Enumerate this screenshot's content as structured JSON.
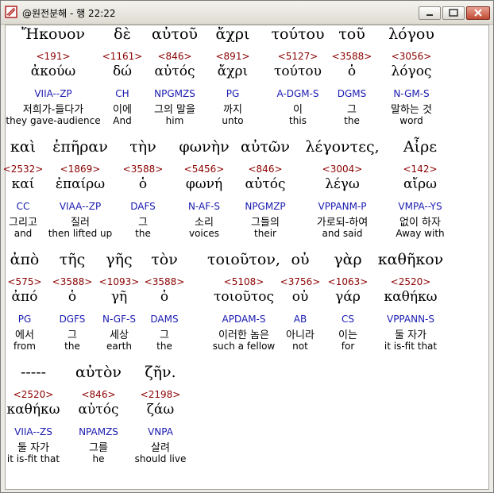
{
  "window": {
    "title": "@원전분해 - 행 22:22"
  },
  "rows": [
    {
      "tokens": [
        {
          "g": "Ἤκουον",
          "sn": "<191>",
          "lx": "ἀκούω",
          "pa": "VIIA--ZP",
          "ko": "저희가-들다가",
          "en": "they gave-audience"
        },
        {
          "g": "δὲ",
          "sn": "<1161>",
          "lx": "δώ",
          "pa": "CH",
          "ko": "이에",
          "en": "And"
        },
        {
          "g": "αὐτοῦ",
          "sn": "<846>",
          "lx": "αὐτός",
          "pa": "NPGMZS",
          "ko": "그의 말을",
          "en": "him"
        },
        {
          "g": "ἄχρι",
          "sn": "<891>",
          "lx": "ἄχρι",
          "pa": "PG",
          "ko": "까지",
          "en": "unto"
        },
        {
          "g": "τούτου",
          "sn": "<5127>",
          "lx": "τούτου",
          "pa": "A-DGM-S",
          "ko": "이",
          "en": "this"
        },
        {
          "g": "τοῦ",
          "sn": "<3588>",
          "lx": "ὁ",
          "pa": "DGMS",
          "ko": "그",
          "en": "the"
        },
        {
          "g": "λόγου",
          "sn": "<3056>",
          "lx": "λόγος",
          "pa": "N-GM-S",
          "ko": "말하는 것",
          "en": "word"
        }
      ]
    },
    {
      "tokens": [
        {
          "g": "καὶ",
          "sn": "<2532>",
          "lx": "καί",
          "pa": "CC",
          "ko": "그리고",
          "en": "and"
        },
        {
          "g": "ἐπῆραν",
          "sn": "<1869>",
          "lx": "ἐπαίρω",
          "pa": "VIAA--ZP",
          "ko": "질러",
          "en": "then lifted up"
        },
        {
          "g": "τὴν",
          "sn": "<3588>",
          "lx": "ὁ",
          "pa": "DAFS",
          "ko": "그",
          "en": "the"
        },
        {
          "g": "φωνὴν",
          "sn": "<5456>",
          "lx": "φωνή",
          "pa": "N-AF-S",
          "ko": "소리",
          "en": "voices"
        },
        {
          "g": "αὐτῶν",
          "sn": "<846>",
          "lx": "αὐτός",
          "pa": "NPGMZP",
          "ko": "그들의",
          "en": "their"
        },
        {
          "g": "λέγοντες,",
          "sn": "<3004>",
          "lx": "λέγω",
          "pa": "VPPANM-P",
          "ko": "가로되-하여",
          "en": "and said"
        },
        {
          "g": "Αἶρε",
          "sn": "<142>",
          "lx": "αἴρω",
          "pa": "VMPA--YS",
          "ko": "없이 하자",
          "en": "Away with"
        }
      ]
    },
    {
      "tokens": [
        {
          "g": "ἀπὸ",
          "sn": "<575>",
          "lx": "ἀπό",
          "pa": "PG",
          "ko": "에서",
          "en": "from"
        },
        {
          "g": "τῆς",
          "sn": "<3588>",
          "lx": "ὁ",
          "pa": "DGFS",
          "ko": "그",
          "en": "the"
        },
        {
          "g": "γῆς",
          "sn": "<1093>",
          "lx": "γῆ",
          "pa": "N-GF-S",
          "ko": "세상",
          "en": "earth"
        },
        {
          "g": "τὸν",
          "sn": "<3588>",
          "lx": "ὁ",
          "pa": "DAMS",
          "ko": "그",
          "en": "the"
        },
        {
          "g": "τοιοῦτον,",
          "sn": "<5108>",
          "lx": "τοιοῦτος",
          "pa": "APDAM-S",
          "ko": "이러한 놈은",
          "en": "such a fellow"
        },
        {
          "g": "οὐ",
          "sn": "<3756>",
          "lx": "οὐ",
          "pa": "AB",
          "ko": "아니라",
          "en": "not"
        },
        {
          "g": "γὰρ",
          "sn": "<1063>",
          "lx": "γάρ",
          "pa": "CS",
          "ko": "이는",
          "en": "for"
        },
        {
          "g": "καθῆκον",
          "sn": "<2520>",
          "lx": "καθήκω",
          "pa": "VPPANN-S",
          "ko": "둘 자가",
          "en": "it is-fit that"
        }
      ]
    },
    {
      "tokens": [
        {
          "g": "-----",
          "sn": "<2520>",
          "lx": "καθήκω",
          "pa": "VIIA--ZS",
          "ko": "둘 자가",
          "en": "it is-fit that"
        },
        {
          "g": "αὐτὸν",
          "sn": "<846>",
          "lx": "αὐτός",
          "pa": "NPAMZS",
          "ko": "그를",
          "en": "he"
        },
        {
          "g": "ζῆν.",
          "sn": "<2198>",
          "lx": "ζάω",
          "pa": "VNPA",
          "ko": "살려",
          "en": "should live"
        }
      ]
    }
  ]
}
